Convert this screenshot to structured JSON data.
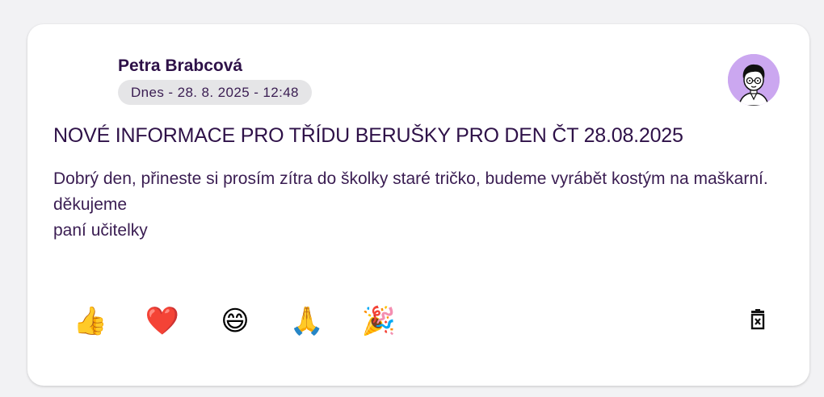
{
  "post": {
    "author": "Petra Brabcová",
    "date": "Dnes - 28. 8. 2025 - 12:48",
    "avatar_icon": "cartoon-person-with-glasses",
    "avatar_bg": "#cba7f0",
    "title": "NOVÉ INFORMACE PRO TŘÍDU BERUŠKY PRO DEN ČT 28.08.2025",
    "body_lines": [
      "Dobrý den, přineste si prosím zítra do školky staré tričko, budeme vyrábět kostým na maškarní.",
      "děkujeme",
      "paní učitelky"
    ]
  },
  "reactions": [
    {
      "name": "thumbs-up",
      "emoji": "👍"
    },
    {
      "name": "heart",
      "emoji": "❤️"
    },
    {
      "name": "grinning-face",
      "emoji": "😄"
    },
    {
      "name": "folded-hands",
      "emoji": "🙏"
    },
    {
      "name": "party-popper",
      "emoji": "🎉"
    }
  ],
  "actions": {
    "delete_icon": "trash-icon"
  },
  "colors": {
    "text_primary": "#2e1148",
    "badge_bg": "#e5e5e7",
    "page_bg": "#f2f2f4"
  }
}
